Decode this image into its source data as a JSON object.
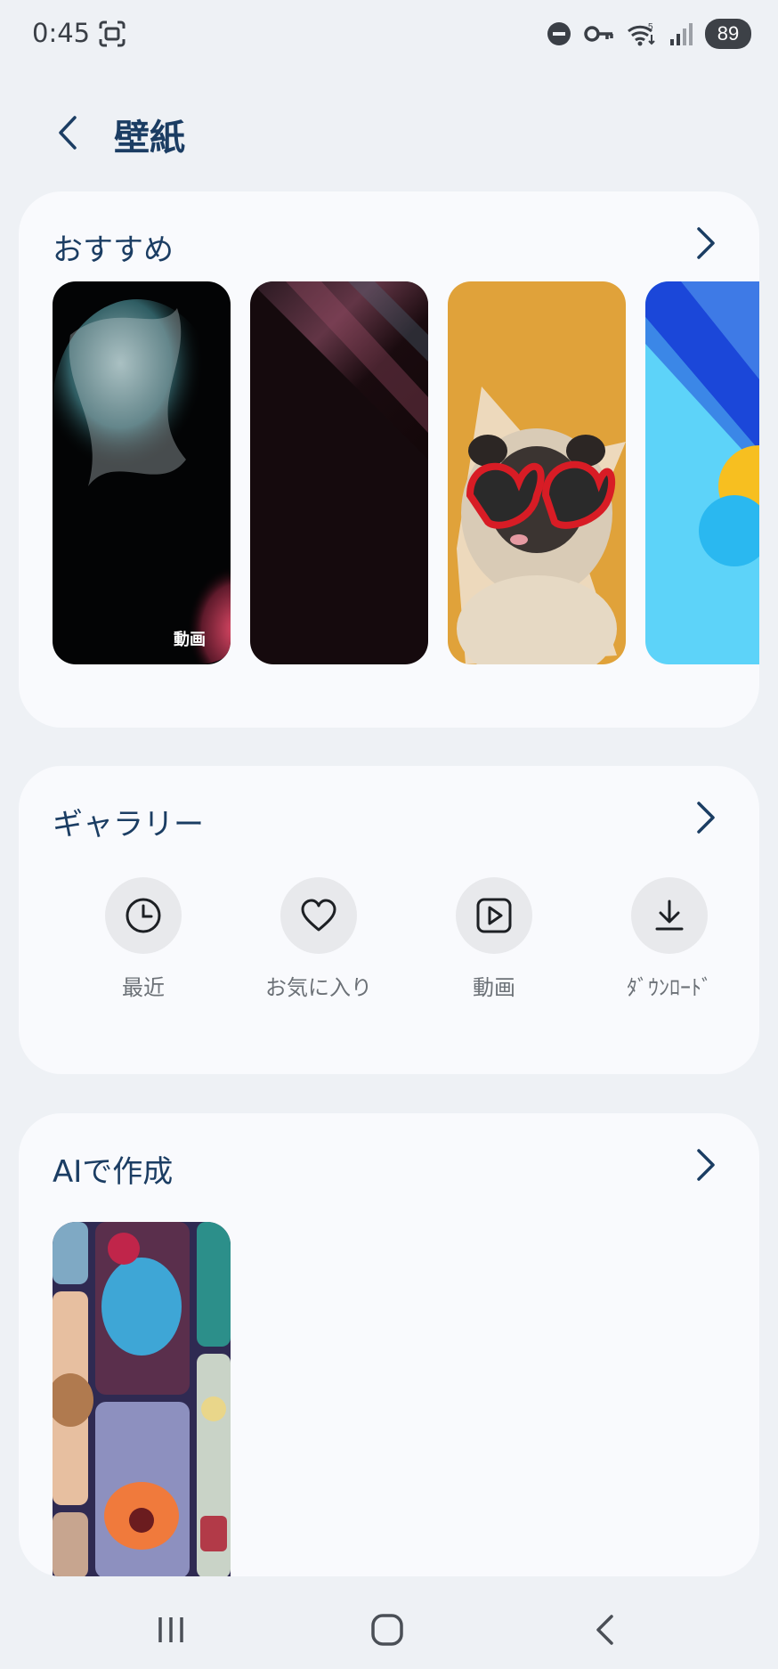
{
  "status_bar": {
    "time": "0:45",
    "icons": [
      "screenshot-icon",
      "do-not-disturb-icon",
      "vpn-key-icon",
      "wifi-icon",
      "signal-icon"
    ],
    "battery": "89"
  },
  "header": {
    "back_icon": "back-chevron-icon",
    "title": "壁紙"
  },
  "recommended": {
    "title": "おすすめ",
    "wallpapers": [
      {
        "name": "particle-splash",
        "badge": "動画"
      },
      {
        "name": "dark-streaks",
        "badge": ""
      },
      {
        "name": "pug-heart-glasses",
        "badge": ""
      },
      {
        "name": "blue-geometric",
        "badge": ""
      }
    ]
  },
  "gallery": {
    "title": "ギャラリー",
    "items": [
      {
        "label": "最近",
        "icon": "clock-icon"
      },
      {
        "label": "お気に入り",
        "icon": "heart-icon"
      },
      {
        "label": "動画",
        "icon": "play-icon"
      },
      {
        "label": "ﾀﾞｳﾝﾛｰﾄﾞ",
        "icon": "download-icon"
      }
    ]
  },
  "ai": {
    "title": "AIで作成"
  },
  "nav": {
    "icons": [
      "recents-icon",
      "home-icon",
      "back-icon"
    ]
  },
  "colors": {
    "background": "#eef1f5",
    "card": "#f9fafd",
    "title": "#1b3d63"
  }
}
